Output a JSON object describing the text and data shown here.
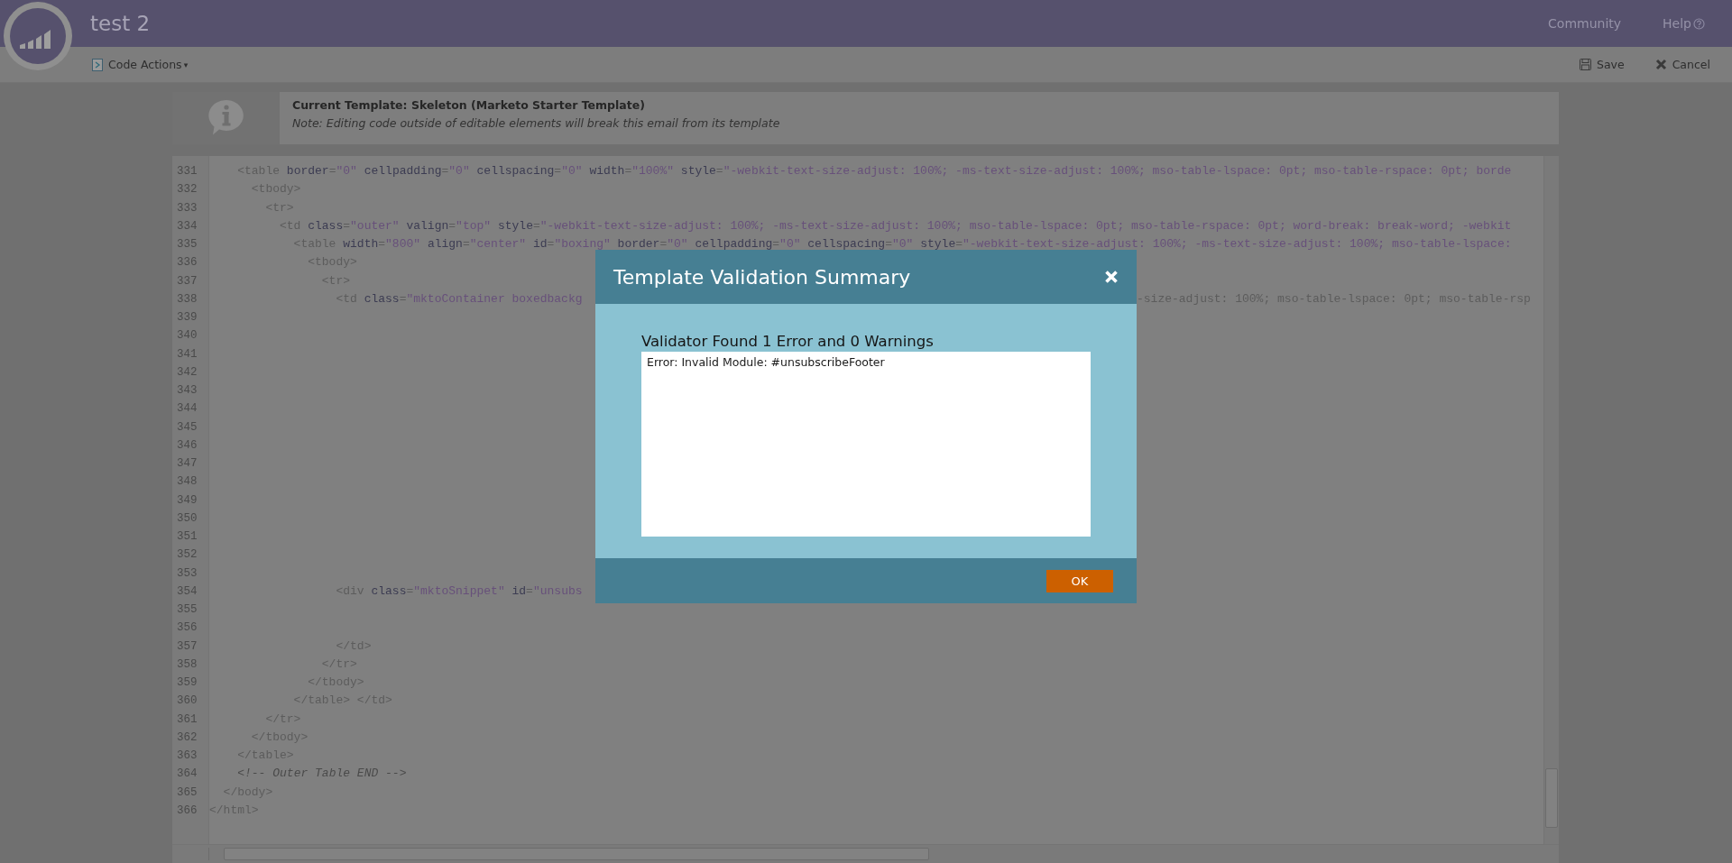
{
  "app_bar": {
    "title": "test 2",
    "links": [
      {
        "kind": "text",
        "label": "Community"
      },
      {
        "kind": "help",
        "label": "Help"
      }
    ]
  },
  "toolbar": {
    "menu": {
      "label": "Code Actions",
      "caret": "▾"
    },
    "actions": [
      {
        "kind": "save",
        "label": "Save"
      },
      {
        "kind": "cancel",
        "label": "Cancel"
      }
    ]
  },
  "template_info": {
    "title": "Current Template: Skeleton (Marketo Starter Template)",
    "note": "Note: Editing code outside of editable elements will break this email from its template"
  },
  "code_editor": {
    "lines": [
      {
        "number": "331",
        "text": "    <table border=\"0\" cellpadding=\"0\" cellspacing=\"0\" width=\"100%\" style=\"-webkit-text-size-adjust: 100%; -ms-text-size-adjust: 100%; mso-table-lspace: 0pt; mso-table-rspace: 0pt; borde"
      },
      {
        "number": "332",
        "text": "      <tbody>"
      },
      {
        "number": "333",
        "text": "        <tr>"
      },
      {
        "number": "334",
        "text": "          <td class=\"outer\" valign=\"top\" style=\"-webkit-text-size-adjust: 100%; -ms-text-size-adjust: 100%; mso-table-lspace: 0pt; mso-table-rspace: 0pt; word-break: break-word; -webkit"
      },
      {
        "number": "335",
        "text": "            <table width=\"800\" align=\"center\" id=\"boxing\" border=\"0\" cellpadding=\"0\" cellspacing=\"0\" style=\"-webkit-text-size-adjust: 100%; -ms-text-size-adjust: 100%; mso-table-lspace:"
      },
      {
        "number": "336",
        "text": "              <tbody>"
      },
      {
        "number": "337",
        "text": "                <tr>"
      },
      {
        "number": "338",
        "text": "                  <td class=\"mktoContainer boxedbackg",
        "text_right": "-size-adjust: 100%; mso-table-lspace: 0pt; mso-table-rsp"
      },
      {
        "number": "339"
      },
      {
        "number": "340"
      },
      {
        "number": "341"
      },
      {
        "number": "342"
      },
      {
        "number": "343"
      },
      {
        "number": "344"
      },
      {
        "number": "345"
      },
      {
        "number": "346"
      },
      {
        "number": "347"
      },
      {
        "number": "348"
      },
      {
        "number": "349"
      },
      {
        "number": "350"
      },
      {
        "number": "351"
      },
      {
        "number": "352"
      },
      {
        "number": "353"
      },
      {
        "number": "354",
        "text": "                  <div class=\"mktoSnippet\" id=\"unsubs"
      },
      {
        "number": "355"
      },
      {
        "number": "356"
      },
      {
        "number": "357",
        "text": "                  </td>"
      },
      {
        "number": "358",
        "text": "                </tr>"
      },
      {
        "number": "359",
        "text": "              </tbody>"
      },
      {
        "number": "360",
        "text": "            </table> </td>"
      },
      {
        "number": "361",
        "text": "        </tr>"
      },
      {
        "number": "362",
        "text": "      </tbody>"
      },
      {
        "number": "363",
        "text": "    </table>"
      },
      {
        "number": "364",
        "text": "    <!-- Outer Table END -->"
      },
      {
        "number": "365",
        "text": "  </body>"
      },
      {
        "number": "366",
        "text": "</html>"
      }
    ]
  },
  "dialog": {
    "title": "Template Validation Summary",
    "heading": "Validator Found 1 Error and 0 Warnings",
    "message": "Error: Invalid Module: #unsubscribeFooter",
    "ok": "OK"
  }
}
